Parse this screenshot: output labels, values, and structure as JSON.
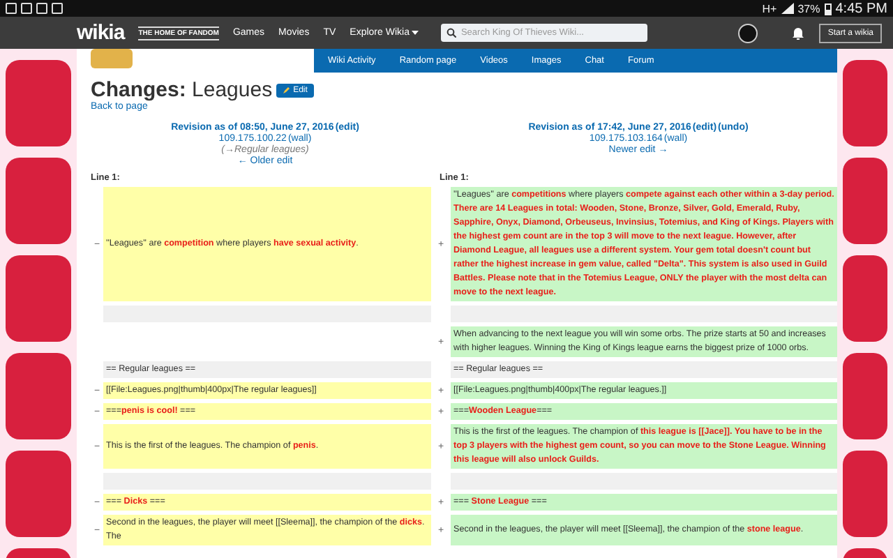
{
  "status_bar": {
    "battery": "37%",
    "time": "4:45 PM",
    "network": "H+"
  },
  "header": {
    "logo": "wikia",
    "tagline": "THE HOME OF FANDOM",
    "nav": [
      {
        "label": "Games",
        "caret": false
      },
      {
        "label": "Movies",
        "caret": false
      },
      {
        "label": "TV",
        "caret": false
      },
      {
        "label": "Explore Wikia",
        "caret": true
      }
    ],
    "search": {
      "placeholder": "Search King Of Thieves Wiki..."
    },
    "start_button": "Start a wikia"
  },
  "wiki_nav": [
    "Wiki Activity",
    "Random page",
    "Videos",
    "Images",
    "Chat",
    "Forum"
  ],
  "page": {
    "title_prefix": "Changes:",
    "title": "Leagues",
    "edit_button": "Edit",
    "back_link": "Back to page"
  },
  "revisions": [
    {
      "title": "Revision as of 08:50, June 27, 2016",
      "actions": [
        "(edit)"
      ],
      "ip": "109.175.100.22",
      "wall": "(wall)",
      "summary": "(→Regular leagues)",
      "nav": "← Older edit",
      "line": "Line 1:"
    },
    {
      "title": "Revision as of 17:42, June 27, 2016",
      "actions": [
        "(edit)",
        "(undo)"
      ],
      "ip": "109.175.103.164",
      "wall": "(wall)",
      "nav": "Newer edit →",
      "line": "Line 1:"
    }
  ],
  "diff_rows": [
    {
      "left": {
        "kind": "deleted",
        "marker": "−",
        "text": "''Leagues'' are **competition** where players **have sexual activity**."
      },
      "right": {
        "kind": "added",
        "marker": "+",
        "text": "''Leagues'' are **competitions** where players **compete against each other within a 3-day period. There are 14 Leagues in total: Wooden, Stone, Bronze, Silver, Gold, Emerald, Ruby, Sapphire, Onyx, Diamond, Orbeuseus, Invinsius, Totemius, and King of Kings. Players with the highest gem count are in the top 3 will move to the next league. However, after Diamond League, all leagues use a different system. Your gem total doesn't count but rather the highest increase in gem value, called \"Delta\". This system is also used in Guild Battles. Please note that in the Totemius League, ONLY the player with the most delta can move to the next league.**"
      }
    },
    {
      "left": {
        "kind": "context"
      },
      "right": {
        "kind": "context"
      }
    },
    {
      "right": {
        "kind": "added",
        "marker": "+",
        "text": "When advancing to the next league you will win some orbs. The prize starts at 50 and increases with higher leagues. Winning the King of Kings league earns the biggest prize of 1000 orbs."
      }
    },
    {
      "left": {
        "kind": "context",
        "text": "== Regular leagues =="
      },
      "right": {
        "kind": "context",
        "text": "== Regular leagues =="
      }
    },
    {
      "left": {
        "kind": "deleted",
        "marker": "−",
        "text": "[[File:Leagues.png|thumb|400px|The regular leagues]]"
      },
      "right": {
        "kind": "added",
        "marker": "+",
        "text": "[[File:Leagues.png|thumb|400px|The regular leagues.]]"
      }
    },
    {
      "left": {
        "kind": "deleted",
        "marker": "−",
        "text": "===**penis is cool!** ==="
      },
      "right": {
        "kind": "added",
        "marker": "+",
        "text": "===**Wooden League**==="
      }
    },
    {
      "left": {
        "kind": "deleted",
        "marker": "−",
        "text": "This is the first of the leagues. The champion of **penis**."
      },
      "right": {
        "kind": "added",
        "marker": "+",
        "text": "This is the first of the leagues. The champion of **this league is [[Jace]]. You have to be in the top 3 players with the highest gem count, so you can move to the Stone League. Winning this league will also unlock Guilds.**"
      }
    },
    {
      "left": {
        "kind": "context"
      },
      "right": {
        "kind": "context"
      }
    },
    {
      "left": {
        "kind": "deleted",
        "marker": "−",
        "text": "=== **Dicks** ==="
      },
      "right": {
        "kind": "added",
        "marker": "+",
        "text": "=== **Stone League** ==="
      }
    },
    {
      "left": {
        "kind": "deleted",
        "marker": "−",
        "text": "Second in the leagues, the player will meet [[Sleema]], the champion of the **dicks**. The"
      },
      "right": {
        "kind": "added",
        "marker": "+",
        "text": "Second in the leagues, the player will meet [[Sleema]], the champion of the **stone league**."
      }
    }
  ]
}
